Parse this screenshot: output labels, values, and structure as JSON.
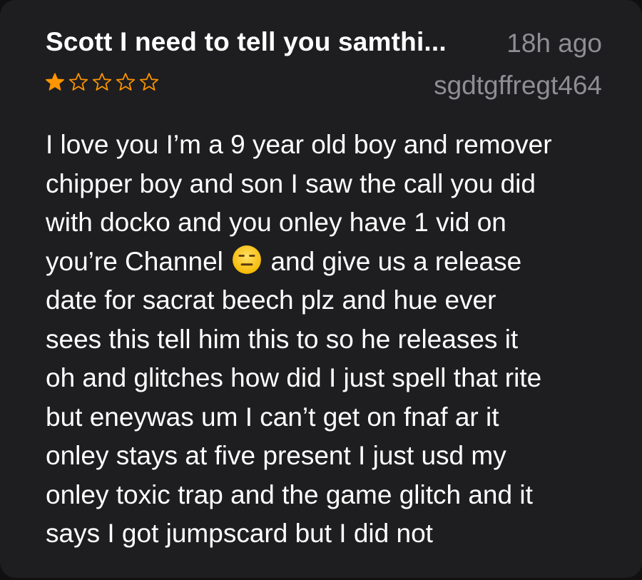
{
  "review": {
    "title": "Scott I need to tell you samthi...",
    "time": "18h ago",
    "author": "sgdtgffregt464",
    "rating": 1,
    "rating_max": 5,
    "accent_color": "#ff9500",
    "emoji_icon": "expressionless-face-icon",
    "body_lines": [
      "I love you I’m a 9 year old boy and remover",
      "chipper boy and son I saw the call you did",
      "with docko and you onley have 1 vid on",
      "you’re Channel",
      "and give us a release",
      "date for sacrat beech plz and hue ever",
      "sees this tell him this to so he releases it",
      "oh and glitches how did I just spell that rite",
      "but eneywas um I can’t get on fnaf ar it",
      "onley stays at five present I just usd my",
      "onley toxic trap and the game glitch and it",
      "says I got jumpscard but I did not"
    ]
  }
}
